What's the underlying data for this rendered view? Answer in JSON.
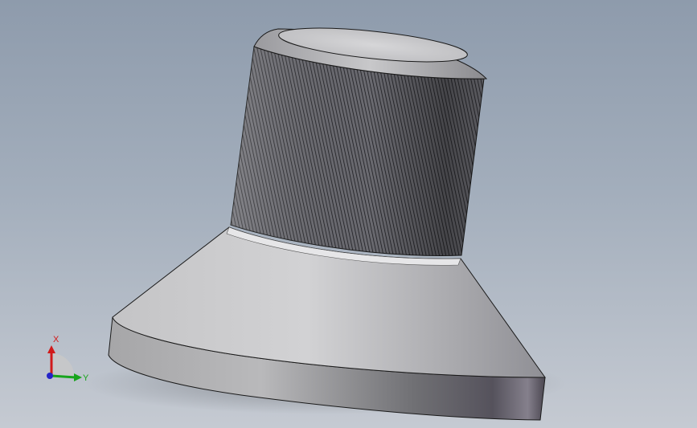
{
  "viewport": {
    "background_top": "#8e9bac",
    "background_bottom": "#c5cad2"
  },
  "model": {
    "parts": [
      "knurled-cylinder",
      "cylinder-top-face",
      "cylinder-chamfer",
      "conical-base",
      "base-flange"
    ],
    "knurl_color": "#3c3c42",
    "body_color": "#b4b4b8",
    "edge_color": "#1a1a1a"
  },
  "triad": {
    "x_label": "X",
    "y_label": "Y",
    "x_color": "#d11a1a",
    "y_color": "#18a41c",
    "z_color": "#2424c8"
  }
}
